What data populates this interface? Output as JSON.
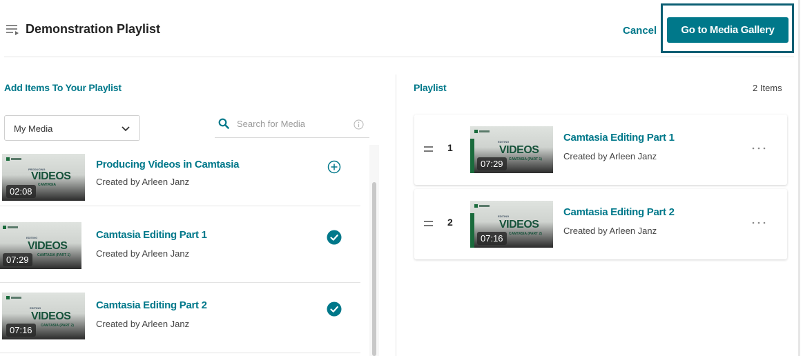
{
  "header": {
    "title": "Demonstration Playlist",
    "cancel_label": "Cancel",
    "gallery_button_label": "Go to Media Gallery",
    "accent_color": "#00788a"
  },
  "left_panel": {
    "heading": "Add Items To Your Playlist",
    "filter_select": {
      "value": "My Media"
    },
    "search": {
      "placeholder": "Search for Media",
      "value": ""
    },
    "items": [
      {
        "title": "Producing Videos in Camtasia",
        "author": "Created by Arleen Janz",
        "duration": "02:08",
        "status": "add",
        "thumb_small": "PRODUCING",
        "thumb_big": "VIDEOS",
        "thumb_sub": "CAMTASIA"
      },
      {
        "title": "Camtasia Editing Part 1",
        "author": "Created by Arleen Janz",
        "duration": "07:29",
        "status": "added",
        "thumb_small": "EDITING",
        "thumb_big": "VIDEOS",
        "thumb_sub": "CAMTASIA (PART 1)"
      },
      {
        "title": "Camtasia Editing Part 2",
        "author": "Created by Arleen Janz",
        "duration": "07:16",
        "status": "added",
        "thumb_small": "EDITING",
        "thumb_big": "VIDEOS",
        "thumb_sub": "CAMTASIA (PART 2)"
      }
    ]
  },
  "right_panel": {
    "heading": "Playlist",
    "count_label": "2 Items",
    "items": [
      {
        "index": "1",
        "title": "Camtasia Editing Part 1",
        "author": "Created by Arleen Janz",
        "duration": "07:29",
        "thumb_small": "EDITING",
        "thumb_big": "VIDEOS",
        "thumb_sub": "CAMTASIA (PART 1)"
      },
      {
        "index": "2",
        "title": "Camtasia Editing Part 2",
        "author": "Created by Arleen Janz",
        "duration": "07:16",
        "thumb_small": "EDITING",
        "thumb_big": "VIDEOS",
        "thumb_sub": "CAMTASIA (PART 2)"
      }
    ]
  },
  "icons": {
    "playlist": "playlist-icon",
    "chevron": "chevron-down-icon",
    "search": "search-icon",
    "info": "info-icon",
    "add": "add-circle-icon",
    "added": "check-circle-icon",
    "drag": "drag-handle-icon",
    "more": "more-options-icon"
  }
}
